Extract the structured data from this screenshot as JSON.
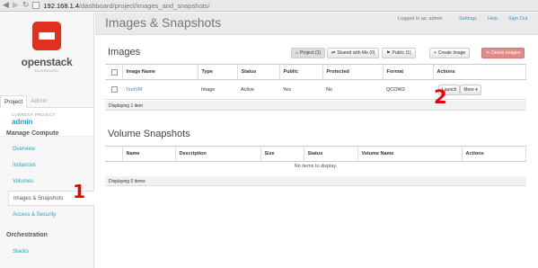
{
  "browser": {
    "url_host": "192.168.1.4",
    "url_path": "/dashboard/project/images_and_snapshots/"
  },
  "sidebar": {
    "logo_word": "openstack",
    "logo_sub": "DASHBOARD",
    "tabs": [
      "Project",
      "Admin"
    ],
    "current_project_label": "CURRENT PROJECT",
    "current_project": "admin",
    "section_compute": "Manage Compute",
    "items": [
      "Overview",
      "Instances",
      "Volumes",
      "Images & Snapshots",
      "Access & Security"
    ],
    "section_orchestration": "Orchestration",
    "orchestration_items": [
      "Stacks"
    ]
  },
  "header": {
    "title": "Images & Snapshots",
    "logged_in": "Logged in as: admin",
    "settings": "Settings",
    "help": "Help",
    "sign_out": "Sign Out"
  },
  "images": {
    "heading": "Images",
    "filters": [
      "Project (1)",
      "Shared with Me (0)",
      "Public (1)"
    ],
    "create_button": "Create Image",
    "delete_button": "Delete Images",
    "columns": [
      "Image Name",
      "Type",
      "Status",
      "Public",
      "Protected",
      "Format",
      "Actions"
    ],
    "rows": [
      {
        "name": "TestVM",
        "type": "Image",
        "status": "Active",
        "public": "Yes",
        "protected": "No",
        "format": "QCOW2",
        "launch": "Launch",
        "more": "More"
      }
    ],
    "footer": "Displaying 1 item"
  },
  "snapshots": {
    "heading": "Volume Snapshots",
    "columns": [
      "Name",
      "Description",
      "Size",
      "Status",
      "Volume Name",
      "Actions"
    ],
    "empty": "No items to display.",
    "footer": "Displaying 0 items"
  },
  "annotations": {
    "marker_1": "1",
    "marker_2": "2"
  },
  "colors": {
    "accent": "#2b9dbd",
    "danger": "#e08a8a",
    "logo": "#e0301e",
    "annotation": "#ee0000"
  }
}
